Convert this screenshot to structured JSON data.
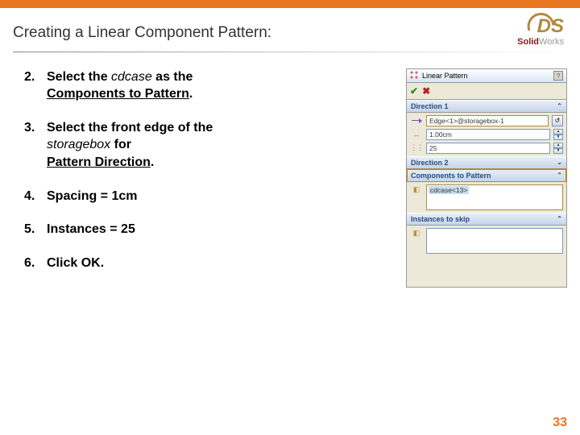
{
  "header": {
    "title": "Creating a Linear Component Pattern:",
    "logo_ds": "DS",
    "logo_bold": "Solid",
    "logo_light": "Works"
  },
  "steps": [
    {
      "num": "2.",
      "parts": [
        {
          "t": "Select the ",
          "cls": "bold"
        },
        {
          "t": "cdcase",
          "cls": "italic"
        },
        {
          "t": " as the ",
          "cls": "bold"
        },
        {
          "br": true
        },
        {
          "t": "Components to Pattern",
          "cls": "bold underline"
        },
        {
          "t": ".",
          "cls": "bold"
        }
      ]
    },
    {
      "num": "3.",
      "parts": [
        {
          "t": "Select the front edge of the",
          "cls": "bold"
        },
        {
          "br": true
        },
        {
          "t": " ",
          "cls": ""
        },
        {
          "t": "storagebox",
          "cls": "italic"
        },
        {
          "t": " for",
          "cls": "bold"
        },
        {
          "br": true
        },
        {
          "t": "Pattern Direction",
          "cls": "bold underline"
        },
        {
          "t": ".",
          "cls": "bold"
        }
      ]
    },
    {
      "num": "4.",
      "parts": [
        {
          "t": "Spacing = 1cm",
          "cls": "bold"
        }
      ]
    },
    {
      "num": "5.",
      "parts": [
        {
          "t": "Instances = 25",
          "cls": "bold"
        }
      ]
    },
    {
      "num": "6.",
      "parts": [
        {
          "t": "Click OK.",
          "cls": "bold"
        }
      ]
    }
  ],
  "panel": {
    "title": "Linear Pattern",
    "help": "?",
    "ok": "✔",
    "cancel": "✖",
    "direction1": {
      "label": "Direction 1",
      "edge": "Edge<1>@storagebox-1",
      "spacing": "1.00cm",
      "instances": "25"
    },
    "direction2": {
      "label": "Direction 2"
    },
    "components": {
      "label": "Components to Pattern",
      "item": "cdcase<13>"
    },
    "skip": {
      "label": "Instances to skip"
    }
  },
  "page_number": "33"
}
